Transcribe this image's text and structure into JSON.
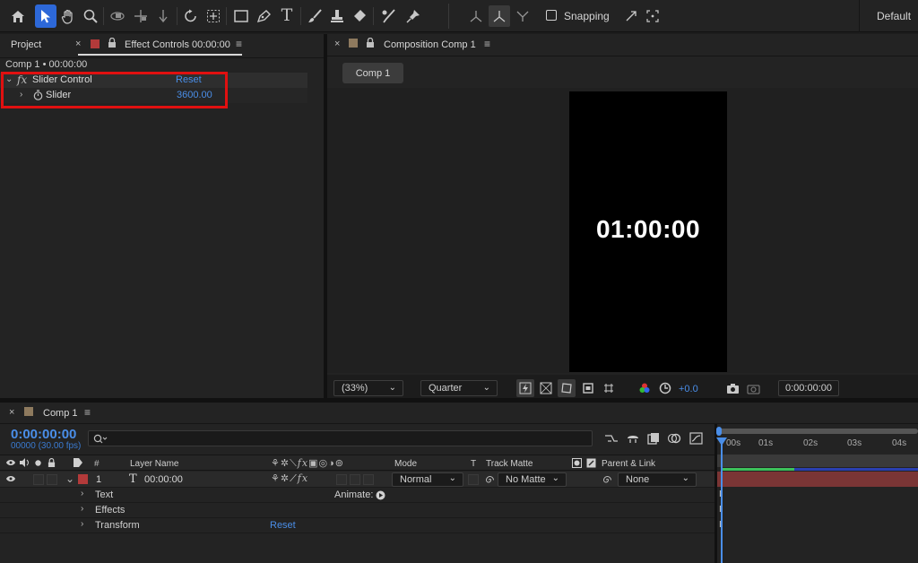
{
  "toolbar": {
    "snapping_label": "Snapping",
    "workspace_label": "Default",
    "tools": [
      "home-icon",
      "selection-arrow-icon",
      "hand-icon",
      "zoom-icon",
      "orbit-camera-icon",
      "pan-camera-icon",
      "dolly-camera-icon",
      "rotate-icon",
      "pan-behind-icon",
      "rectangle-icon",
      "pen-icon",
      "type-icon",
      "brush-icon",
      "clone-stamp-icon",
      "eraser-icon",
      "roto-brush-icon",
      "puppet-pin-icon"
    ]
  },
  "left_panel": {
    "project_tab": "Project",
    "effect_controls_tab": "Effect Controls 00:00:00",
    "breadcrumb": "Comp 1 • 00:00:00",
    "effect": {
      "fx_label": "fx",
      "name": "Slider Control",
      "reset_label": "Reset",
      "property_name": "Slider",
      "property_value": "3600.00"
    }
  },
  "composition": {
    "tab_title": "Composition Comp 1",
    "comp_chip": "Comp 1",
    "display_text": "01:00:00",
    "zoom": "(33%)",
    "resolution": "Quarter",
    "exposure": "+0.0",
    "current_time": "0:00:00:00"
  },
  "timeline": {
    "tab_title": "Comp 1",
    "timecode": "0:00:00:00",
    "frames_fps": "00000 (30.00 fps)",
    "search_placeholder": "",
    "columns": {
      "number": "#",
      "layer_name": "Layer Name",
      "mode": "Mode",
      "t": "T",
      "track_matte": "Track Matte",
      "parent_link": "Parent & Link"
    },
    "layer": {
      "number": "1",
      "type_glyph": "T",
      "name": "00:00:00",
      "mode": "Normal",
      "track_matte": "No Matte",
      "parent": "None"
    },
    "sub_rows": {
      "text": "Text",
      "animate": "Animate:",
      "effects": "Effects",
      "transform": "Transform",
      "transform_reset": "Reset"
    },
    "ruler_ticks": [
      "00s",
      "01s",
      "02s",
      "03s",
      "04s"
    ]
  },
  "colors": {
    "accent_blue": "#4a8ee8",
    "label_red": "#b33a3a",
    "highlight_box": "#e01010",
    "layer_bar": "#7a3535",
    "work_area_green": "#3cc05a",
    "work_area_blue": "#2a3fb0"
  }
}
